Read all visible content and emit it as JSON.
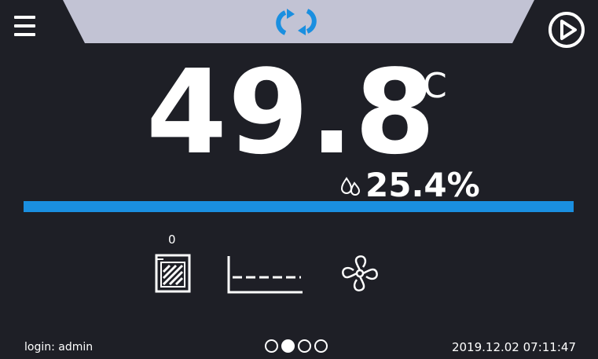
{
  "colors": {
    "background": "#1e1f26",
    "top_tab": "#c2c3d4",
    "accent": "#1a8fe0",
    "text": "#ffffff"
  },
  "header": {
    "menu_icon": "hamburger-menu-icon",
    "mode_icon": "sync-arrows-icon",
    "play_icon": "play-circle-icon"
  },
  "reading": {
    "temperature": "49.8",
    "temperature_unit": "°C",
    "humidity": "25.4%",
    "humidity_icon": "water-drops-icon"
  },
  "progress": {
    "fraction": 1.0
  },
  "status_icons": {
    "door_count": "0",
    "door_icon": "chamber-door-icon",
    "program_icon": "program-profile-icon",
    "fan_icon": "fan-icon"
  },
  "footer": {
    "login": "login: admin",
    "page_count": 4,
    "active_page": 1,
    "datetime": "2019.12.02  07:11:47"
  }
}
